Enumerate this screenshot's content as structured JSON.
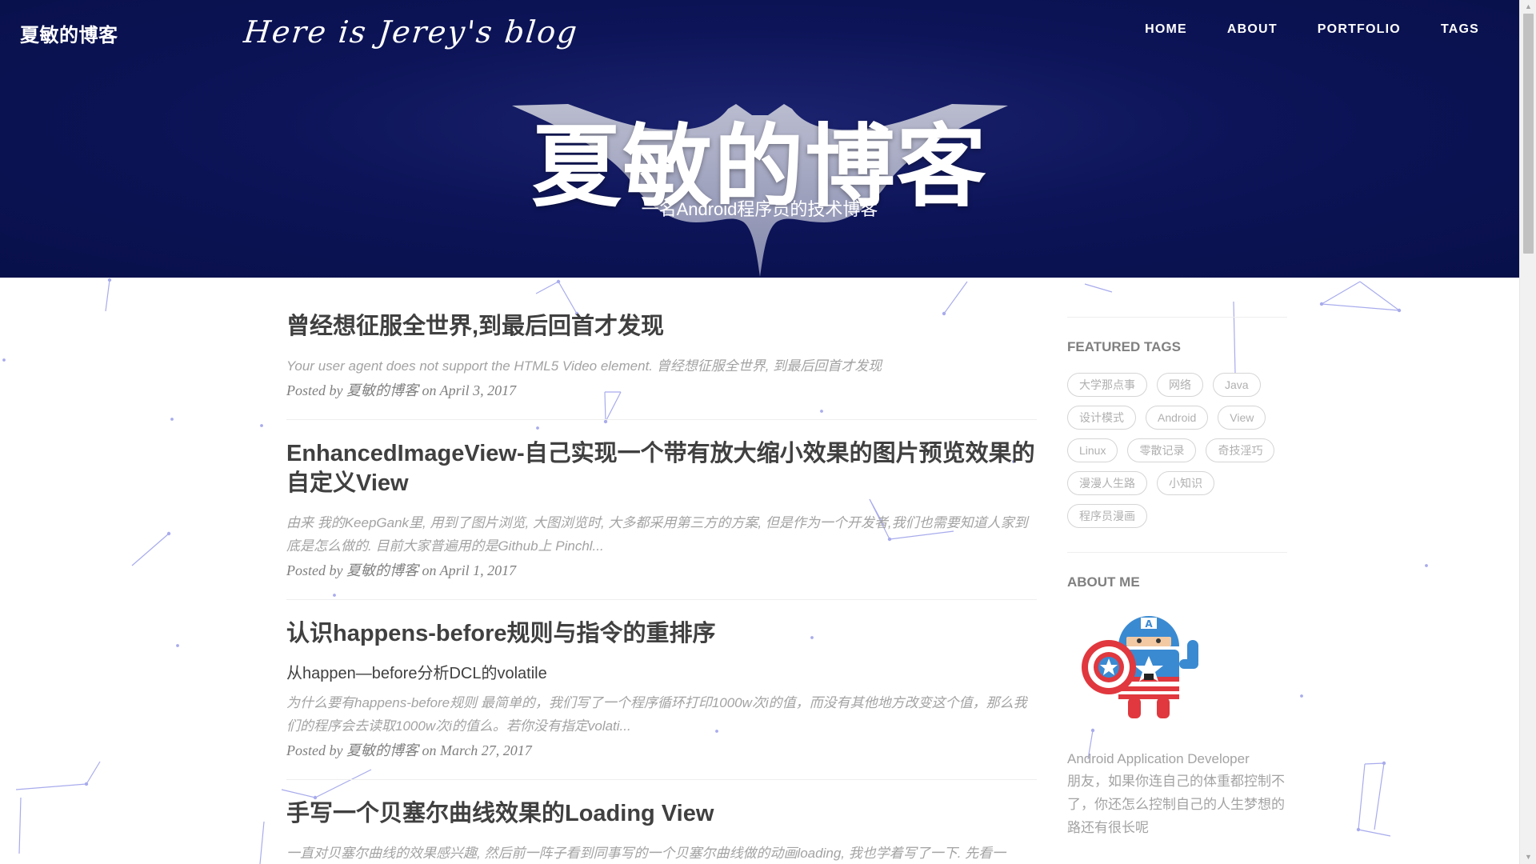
{
  "header": {
    "brand": "夏敏的博客",
    "script_title": "Here is Jerey's blog",
    "nav": [
      {
        "label": "HOME"
      },
      {
        "label": "ABOUT"
      },
      {
        "label": "PORTFOLIO"
      },
      {
        "label": "TAGS"
      }
    ],
    "hero_title": "夏敏的博客",
    "hero_subtitle": "一名Android程序员的技术博客"
  },
  "posts": [
    {
      "title": "曾经想征服全世界,到最后回首才发现",
      "subtitle": "",
      "excerpt": "Your user agent does not support the HTML5 Video element. 曾经想征服全世界, 到最后回首才发现",
      "posted_by": "Posted by",
      "author": "夏敏的博客",
      "on": "on",
      "date": "April 3, 2017"
    },
    {
      "title": "EnhancedImageView-自己实现一个带有放大缩小效果的图片预览效果的自定义View",
      "subtitle": "",
      "excerpt": "由来 我的KeepGank里, 用到了图片浏览, 大图浏览时, 大多都采用第三方的方案, 但是作为一个开发者,我们也需要知道人家到底是怎么做的. 目前大家普遍用的是Github上 Pinchl...",
      "posted_by": "Posted by",
      "author": "夏敏的博客",
      "on": "on",
      "date": "April 1, 2017"
    },
    {
      "title": "认识happens-before规则与指令的重排序",
      "subtitle": "从happen—before分析DCL的volatile",
      "excerpt": "为什么要有happens-before规则 最简单的，我们写了一个程序循环打印1000w次i的值，而没有其他地方改变这个值，那么我们的程序会去读取1000w次i的值么。若你没有指定volati...",
      "posted_by": "Posted by",
      "author": "夏敏的博客",
      "on": "on",
      "date": "March 27, 2017"
    },
    {
      "title": "手写一个贝塞尔曲线效果的Loading View",
      "subtitle": "",
      "excerpt": "一直对贝塞尔曲线的效果感兴趣, 然后前一阵子看到同事写的一个贝塞尔曲线做的动画loading, 我也学着写了一下. 先看一",
      "posted_by": "",
      "author": "",
      "on": "",
      "date": ""
    }
  ],
  "sidebar": {
    "featured_tags_heading": "FEATURED TAGS",
    "tags": [
      "大学那点事",
      "网络",
      "Java",
      "设计模式",
      "Android",
      "View",
      "Linux",
      "零散记录",
      "奇技淫巧",
      "漫漫人生路",
      "小知识",
      "程序员漫画"
    ],
    "about_heading": "ABOUT ME",
    "about_role": "Android Application Developer",
    "about_text": "朋友，如果你连自己的体重都控制不了，你还怎么控制自己的人生梦想的路还有很长呢"
  },
  "colors": {
    "hero_bg": "#0d1458",
    "text": "#404040",
    "muted": "#a3a3a3",
    "network_lines": "#7e86e0"
  }
}
